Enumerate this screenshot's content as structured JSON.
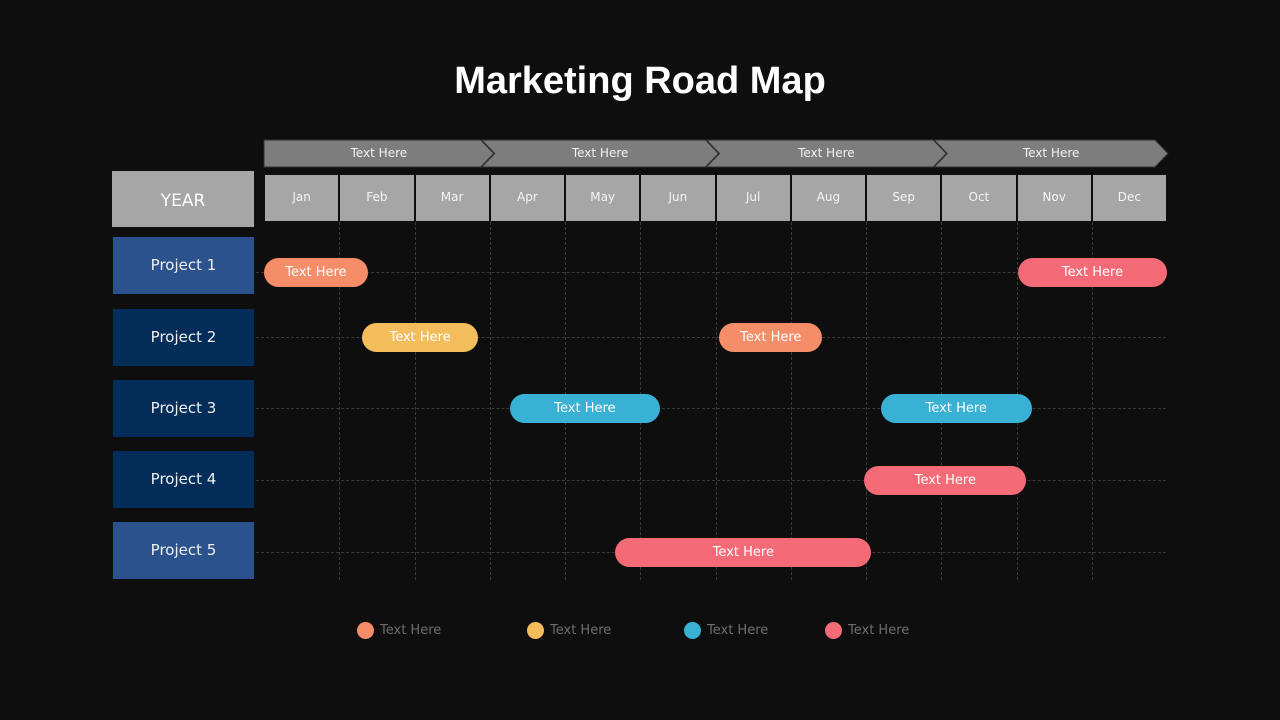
{
  "title": "Marketing Road Map",
  "year_label": "YEAR",
  "phases": [
    "Text Here",
    "Text Here",
    "Text Here",
    "Text Here"
  ],
  "months": [
    "Jan",
    "Feb",
    "Mar",
    "Apr",
    "May",
    "Jun",
    "Jul",
    "Aug",
    "Sep",
    "Oct",
    "Nov",
    "Dec"
  ],
  "projects": [
    {
      "label": "Project 1",
      "color": "#2b528c"
    },
    {
      "label": "Project 2",
      "color": "#042d5a"
    },
    {
      "label": "Project 3",
      "color": "#042d5a"
    },
    {
      "label": "Project 4",
      "color": "#042d5a"
    },
    {
      "label": "Project 5",
      "color": "#2b528c"
    }
  ],
  "colors": {
    "orange": "#f58d68",
    "yellow": "#f3bd5c",
    "blue": "#38b1d4",
    "red": "#f46a76"
  },
  "tasks": [
    {
      "project": 0,
      "label": "Text Here",
      "color": "orange",
      "start": 0,
      "end": 1.38
    },
    {
      "project": 0,
      "label": "Text Here",
      "color": "red",
      "start": 10.02,
      "end": 12.0
    },
    {
      "project": 1,
      "label": "Text Here",
      "color": "yellow",
      "start": 1.3,
      "end": 2.85
    },
    {
      "project": 1,
      "label": "Text Here",
      "color": "orange",
      "start": 6.05,
      "end": 7.42
    },
    {
      "project": 2,
      "label": "Text Here",
      "color": "blue",
      "start": 3.27,
      "end": 5.26
    },
    {
      "project": 2,
      "label": "Text Here",
      "color": "blue",
      "start": 8.2,
      "end": 10.2
    },
    {
      "project": 3,
      "label": "Text Here",
      "color": "red",
      "start": 7.98,
      "end": 10.13
    },
    {
      "project": 4,
      "label": "Text Here",
      "color": "red",
      "start": 4.67,
      "end": 8.07
    }
  ],
  "legend": [
    {
      "label": "Text Here",
      "color": "orange"
    },
    {
      "label": "Text Here",
      "color": "yellow"
    },
    {
      "label": "Text Here",
      "color": "blue"
    },
    {
      "label": "Text Here",
      "color": "red"
    }
  ]
}
